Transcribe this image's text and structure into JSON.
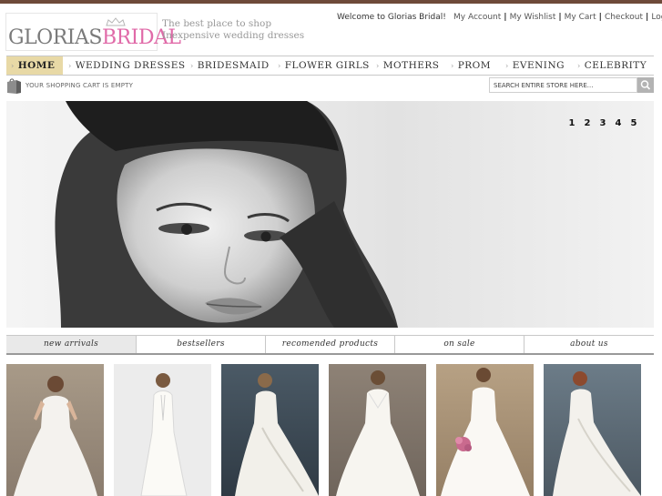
{
  "header": {
    "brand_left": "GLORIAS",
    "brand_right": "BRIDAL",
    "tagline_line1": "The best place to shop",
    "tagline_line2": "Inexpensive wedding dresses",
    "welcome": "Welcome to Glorias Bridal!",
    "links": [
      "My Account",
      "My Wishlist",
      "My Cart",
      "Checkout",
      "Log In"
    ]
  },
  "nav": {
    "items": [
      "HOME",
      "WEDDING DRESSES",
      "BRIDESMAID",
      "FLOWER GIRLS",
      "MOTHERS",
      "PROM",
      "EVENING",
      "CELEBRITY"
    ],
    "active": "HOME"
  },
  "cart": {
    "status": "YOUR SHOPPING CART IS EMPTY"
  },
  "search": {
    "placeholder": "SEARCH ENTIRE STORE HERE..."
  },
  "slider": {
    "pages": [
      "1",
      "2",
      "3",
      "4",
      "5"
    ]
  },
  "tabs": {
    "items": [
      "new arrivals",
      "bestsellers",
      "recomended products",
      "on sale",
      "about us"
    ],
    "active": "new arrivals"
  },
  "colors": {
    "accent": "#e8d9a6",
    "brand_pink": "#e06aa8",
    "topbar": "#6e4a3a"
  },
  "icons": {
    "cart": "shopping-bag-icon",
    "search": "search-icon",
    "nav_arrow": "chevron-right-icon"
  }
}
